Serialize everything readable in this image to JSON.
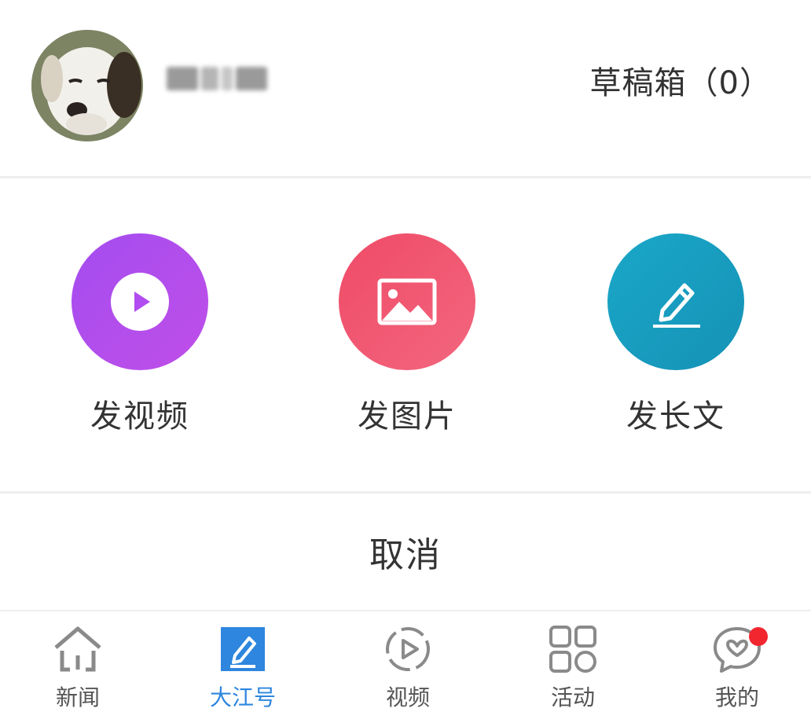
{
  "header": {
    "drafts_label": "草稿箱（0）"
  },
  "actions": [
    {
      "label": "发视频",
      "icon": "play-icon",
      "color": "#b04cf0"
    },
    {
      "label": "发图片",
      "icon": "image-icon",
      "color": "#f0536e"
    },
    {
      "label": "发长文",
      "icon": "pencil-icon",
      "color": "#18a0c2"
    }
  ],
  "cancel_label": "取消",
  "tabs": [
    {
      "label": "新闻",
      "icon": "home-icon",
      "active": false
    },
    {
      "label": "大江号",
      "icon": "compose-icon",
      "active": true
    },
    {
      "label": "视频",
      "icon": "video-icon",
      "active": false
    },
    {
      "label": "活动",
      "icon": "grid-icon",
      "active": false
    },
    {
      "label": "我的",
      "icon": "heart-chat-icon",
      "active": false,
      "badge": true
    }
  ],
  "colors": {
    "active_tab": "#2e86de",
    "badge": "#f2262f"
  }
}
